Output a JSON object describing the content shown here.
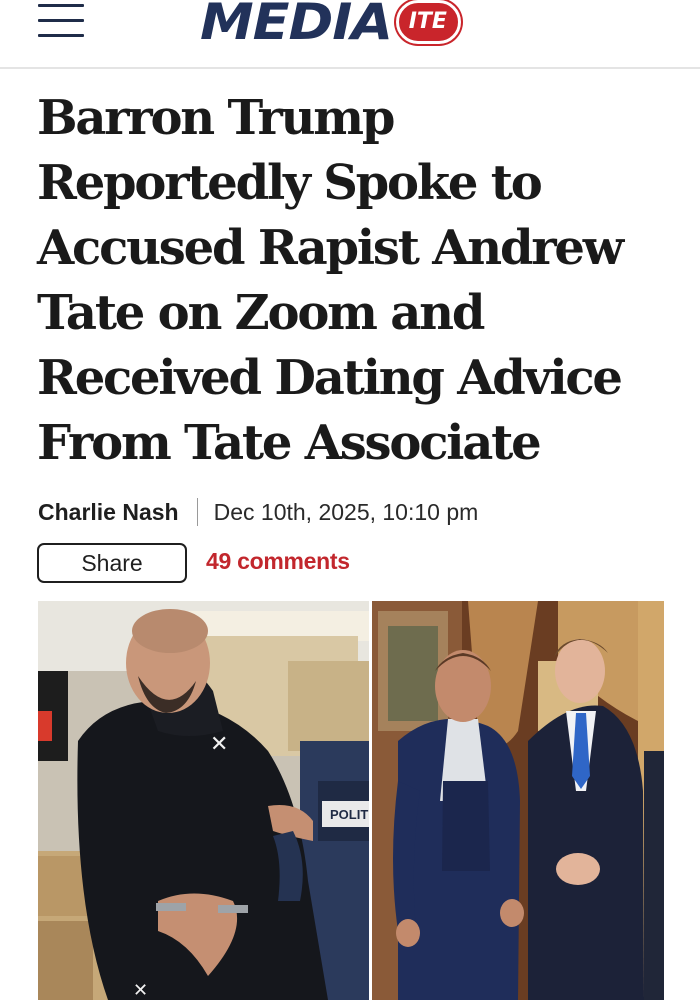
{
  "header": {
    "logo_main": "MEDIA",
    "logo_badge": "ITE",
    "menu_icon": "hamburger-menu-icon"
  },
  "article": {
    "headline": "Barron Trump Reportedly Spoke to Accused Rapist Andrew Tate on Zoom and Received Dating Advice From Tate Associate",
    "author": "Charlie Nash",
    "date": "Dec 10th, 2025, 10:10 pm",
    "share_label": "Share",
    "comments_label": "49 comments"
  },
  "photo": {
    "left_vest_text": "POLITI"
  },
  "colors": {
    "brand_navy": "#22325a",
    "brand_red": "#c9252b",
    "comments_red": "#c2272d"
  }
}
